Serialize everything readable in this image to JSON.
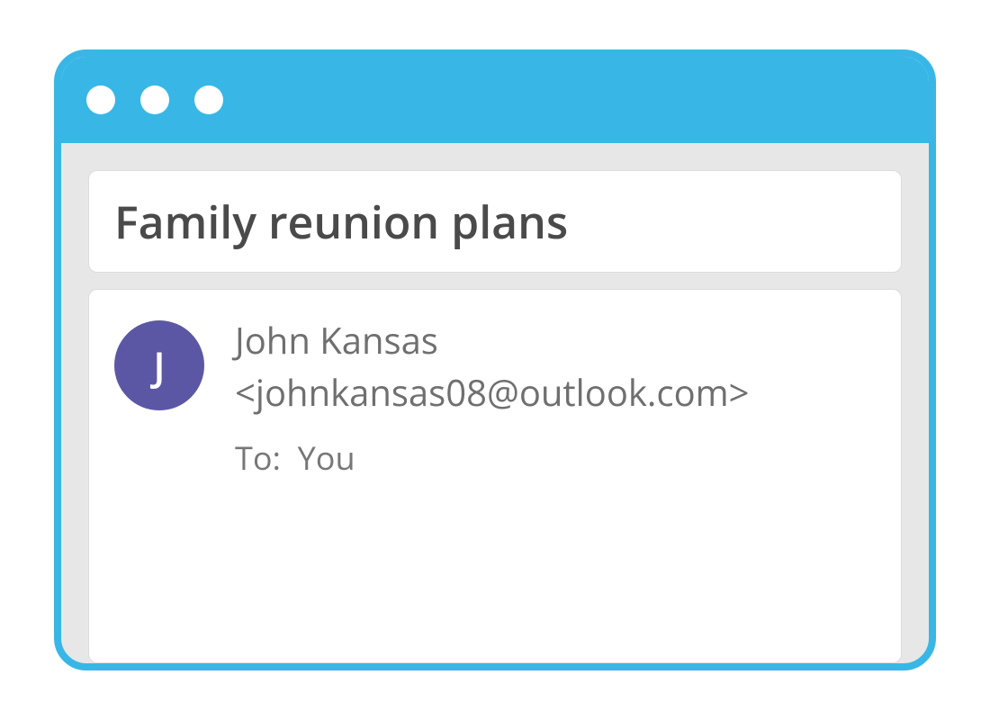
{
  "message": {
    "subject": "Family reunion plans",
    "sender_name": "John Kansas",
    "sender_email": "<johnkansas08@outlook.com>",
    "avatar_initial": "J",
    "to_label": "To:",
    "to_value": "You"
  }
}
